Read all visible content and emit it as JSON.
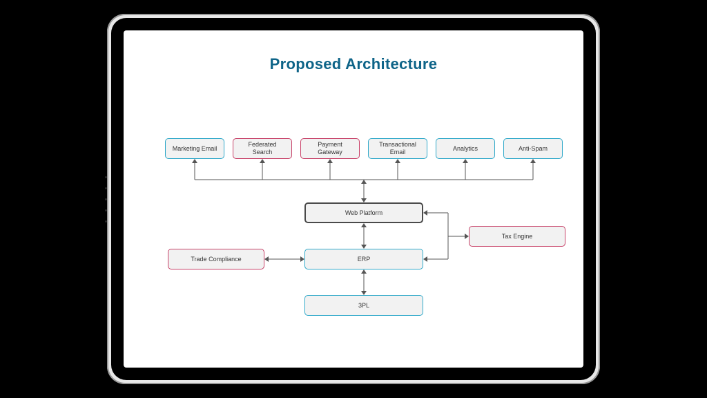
{
  "title": "Proposed Architecture",
  "nodes": {
    "marketing_email": {
      "label": "Marketing Email",
      "color": "teal"
    },
    "federated_search": {
      "label": "Federated Search",
      "color": "pink"
    },
    "payment_gateway": {
      "label": "Payment Gateway",
      "color": "pink"
    },
    "transactional_email": {
      "label": "Transactional Email",
      "color": "teal"
    },
    "analytics": {
      "label": "Analytics",
      "color": "teal"
    },
    "anti_spam": {
      "label": "Anti-Spam",
      "color": "teal"
    },
    "web_platform": {
      "label": "Web Platform",
      "color": "dark"
    },
    "erp": {
      "label": "ERP",
      "color": "teal"
    },
    "trade_compliance": {
      "label": "Trade Compliance",
      "color": "pink"
    },
    "tax_engine": {
      "label": "Tax Engine",
      "color": "pink"
    },
    "three_pl": {
      "label": "3PL",
      "color": "teal"
    }
  },
  "edges": [
    {
      "from": "web_platform",
      "to": "marketing_email",
      "bidir": true
    },
    {
      "from": "web_platform",
      "to": "federated_search",
      "bidir": true
    },
    {
      "from": "web_platform",
      "to": "payment_gateway",
      "bidir": true
    },
    {
      "from": "web_platform",
      "to": "transactional_email",
      "bidir": true
    },
    {
      "from": "web_platform",
      "to": "analytics",
      "bidir": true
    },
    {
      "from": "web_platform",
      "to": "anti_spam",
      "bidir": true
    },
    {
      "from": "web_platform",
      "to": "erp",
      "bidir": true
    },
    {
      "from": "web_platform",
      "to": "tax_engine",
      "bidir": true
    },
    {
      "from": "erp",
      "to": "trade_compliance",
      "bidir": true
    },
    {
      "from": "erp",
      "to": "tax_engine",
      "bidir": true
    },
    {
      "from": "erp",
      "to": "three_pl",
      "bidir": true
    }
  ]
}
